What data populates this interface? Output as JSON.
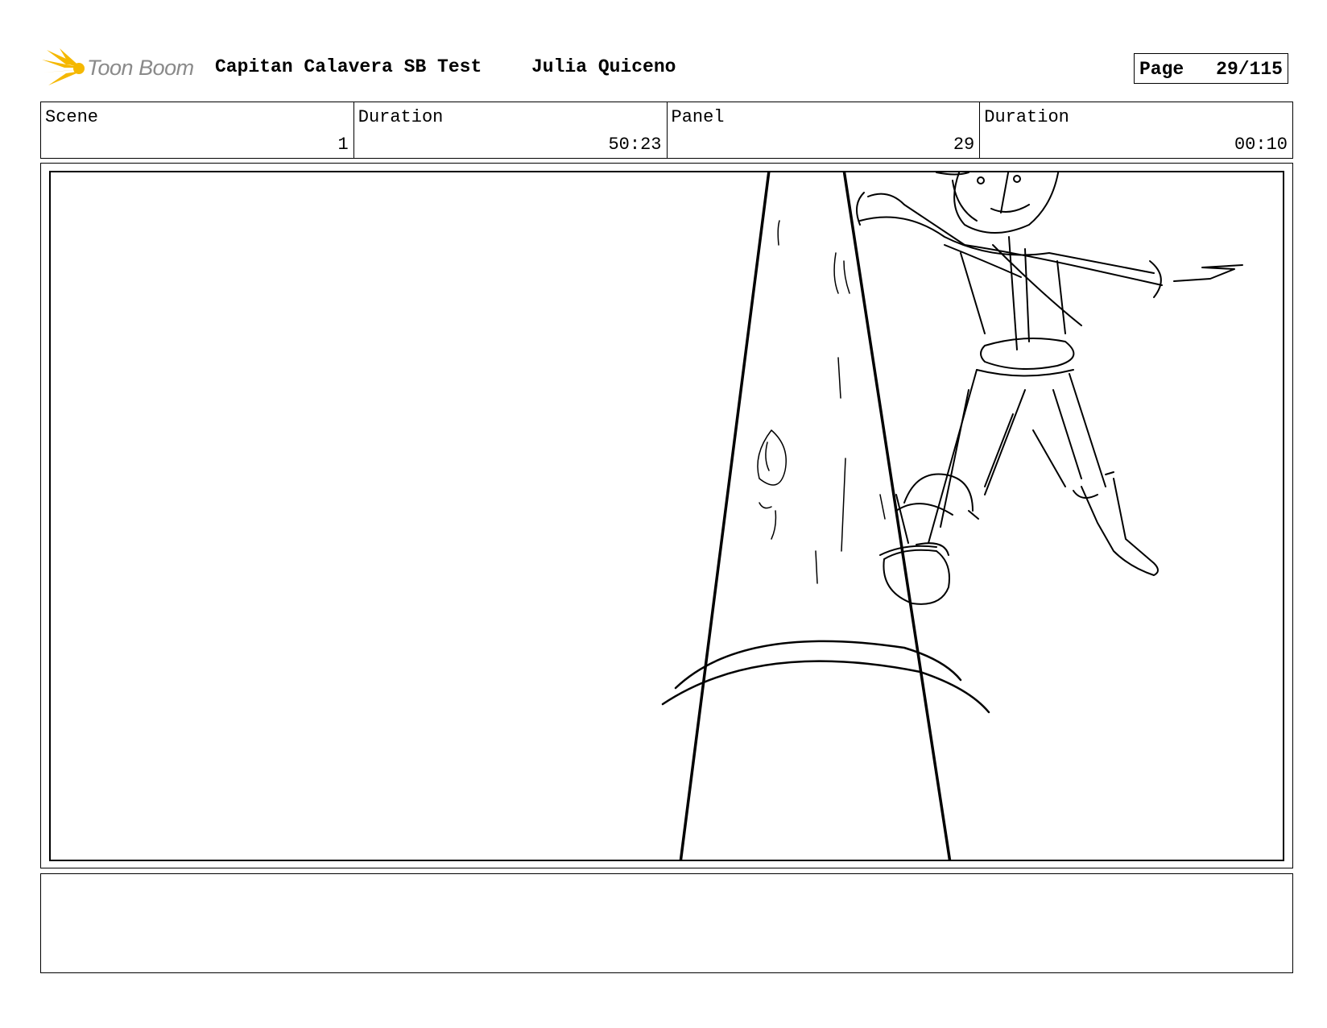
{
  "header": {
    "logo_text": "Toon Boom",
    "project_title": "Capitan Calavera SB Test",
    "author": "Julia Quiceno",
    "page_label": "Page",
    "page_value": "29/115"
  },
  "info": {
    "scene_label": "Scene",
    "scene_value": "1",
    "scene_duration_label": "Duration",
    "scene_duration_value": "50:23",
    "panel_label": "Panel",
    "panel_value": "29",
    "panel_duration_label": "Duration",
    "panel_duration_value": "00:10"
  },
  "notes": {
    "text": ""
  },
  "colors": {
    "logo_accent": "#f5b800",
    "logo_text": "#8a8a8a",
    "line": "#000000"
  },
  "icons": {
    "logo": "toon-boom-starburst-icon"
  }
}
